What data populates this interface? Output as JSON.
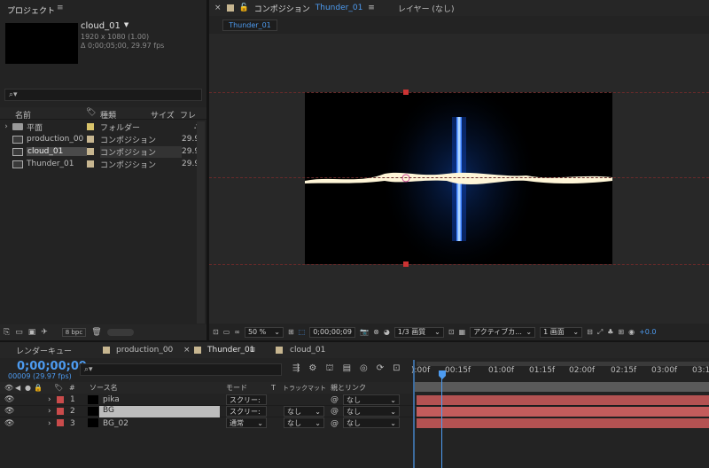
{
  "project": {
    "title": "プロジェクト",
    "comp_name": "cloud_01",
    "comp_res": "1920 x 1080 (1.00)",
    "comp_dur": "Δ 0;00;05;00, 29.97 fps",
    "search_placeholder": "",
    "col_name": "名前",
    "col_type": "種類",
    "col_size": "サイズ",
    "col_fr": "フレ",
    "items": [
      {
        "name": "平面",
        "type": "フォルダー",
        "fps": "",
        "color": "#d9c46b",
        "kind": "folder"
      },
      {
        "name": "production_00",
        "type": "コンポジション",
        "fps": "29.9",
        "color": "#c7b690",
        "kind": "comp"
      },
      {
        "name": "cloud_01",
        "type": "コンポジション",
        "fps": "29.9",
        "color": "#c7b690",
        "kind": "comp"
      },
      {
        "name": "Thunder_01",
        "type": "コンポジション",
        "fps": "29.9",
        "color": "#c7b690",
        "kind": "comp"
      }
    ],
    "bpc": "8 bpc"
  },
  "viewer": {
    "tab_close": "×",
    "tab_label": "コンポジション",
    "tab_comp": "Thunder_01",
    "layer_label": "レイヤー (なし)",
    "sub_tab": "Thunder_01",
    "zoom": "50 %",
    "timecode": "0;00;00;09",
    "resolution": "1/3 画質",
    "camera": "アクティブカ...",
    "views": "1 画面",
    "exposure": "+0.0"
  },
  "timeline": {
    "tabs": [
      {
        "label": "レンダーキュー",
        "color": ""
      },
      {
        "label": "production_00",
        "color": "#c7b690"
      },
      {
        "label": "Thunder_01",
        "color": "#c7b690"
      },
      {
        "label": "cloud_01",
        "color": "#c7b690"
      }
    ],
    "timecode": "0;00;00;09",
    "frames": "00009 (29.97 fps)",
    "col_hash": "#",
    "col_source": "ソース名",
    "col_mode": "モード",
    "col_t": "T",
    "col_track": "トラックマット",
    "col_parent": "親とリンク",
    "ruler": [
      "):00f",
      "00:15f",
      "01:00f",
      "01:15f",
      "02:00f",
      "02:15f",
      "03:00f",
      "03:1"
    ],
    "layers": [
      {
        "num": "1",
        "name": "pika",
        "mode": "スクリー:",
        "track": "",
        "parent": "なし"
      },
      {
        "num": "2",
        "name": "BG",
        "mode": "スクリー:",
        "track": "なし",
        "parent": "なし"
      },
      {
        "num": "3",
        "name": "BG_02",
        "mode": "通常",
        "track": "なし",
        "parent": "なし"
      }
    ],
    "label_color": "#c94b4b"
  }
}
